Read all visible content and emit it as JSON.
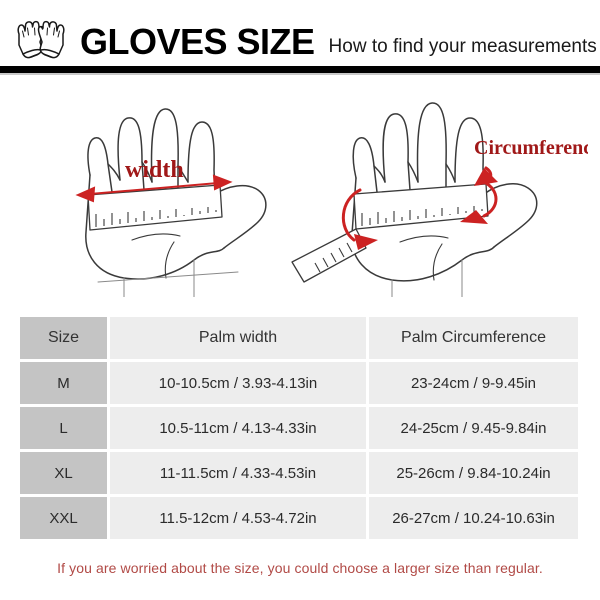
{
  "header": {
    "logo_icon": "gloves-pair-icon",
    "title": "GLOVES SIZE",
    "subtitle": "How to find your measurements"
  },
  "diagrams": {
    "left": {
      "icon": "hand-palm-width-diagram",
      "label": "width",
      "label_color": "#a01818",
      "description": "Open palm with measuring tape laid across the palm, red double-headed arrow spanning the palm width"
    },
    "right": {
      "icon": "hand-palm-circumference-diagram",
      "label": "Circumference",
      "label_color": "#a01818",
      "description": "Open palm with measuring tape wrapped around the palm, red curved arrows showing wrap direction"
    }
  },
  "table": {
    "columns": [
      "Size",
      "Palm width",
      "Palm Circumference"
    ],
    "rows": [
      {
        "size": "M",
        "palm_width": "10-10.5cm / 3.93-4.13in",
        "palm_circumference": "23-24cm / 9-9.45in"
      },
      {
        "size": "L",
        "palm_width": "10.5-11cm / 4.13-4.33in",
        "palm_circumference": "24-25cm / 9.45-9.84in"
      },
      {
        "size": "XL",
        "palm_width": "11-11.5cm / 4.33-4.53in",
        "palm_circumference": "25-26cm / 9.84-10.24in"
      },
      {
        "size": "XXL",
        "palm_width": "11.5-12cm / 4.53-4.72in",
        "palm_circumference": "26-27cm / 10.24-10.63in"
      }
    ]
  },
  "footer": {
    "note": "If you are worried about the size, you could choose a larger size than regular."
  },
  "colors": {
    "accent_red": "#a01818",
    "footer_red": "#b14a46",
    "size_cell_bg": "#c4c4c4",
    "data_cell_bg": "#ededed",
    "line_art": "#3a3a3a",
    "rule": "#000000"
  }
}
